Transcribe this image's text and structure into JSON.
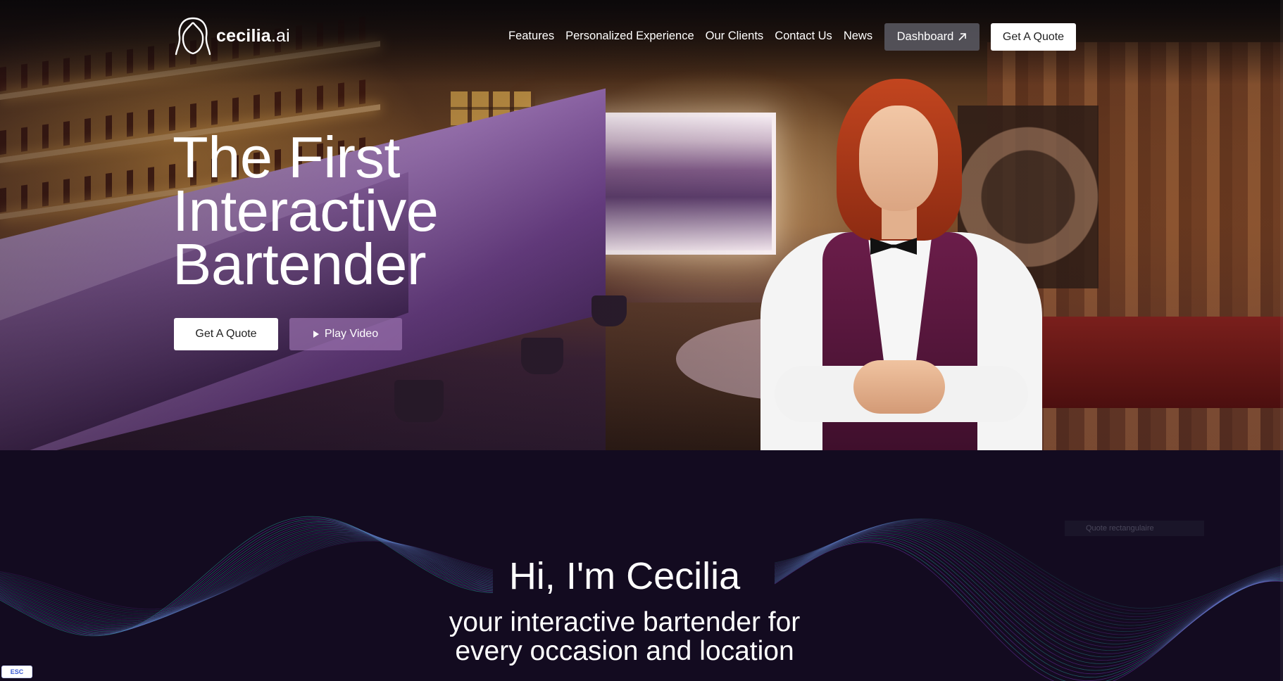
{
  "brand": {
    "name": "cecilia",
    "suffix": ".ai"
  },
  "nav": {
    "items": [
      "Features",
      "Personalized Experience",
      "Our Clients",
      "Contact Us",
      "News"
    ],
    "dashboard_label": "Dashboard",
    "quote_label": "Get A Quote"
  },
  "hero": {
    "title_lines": [
      "The First",
      "Interactive",
      "Bartender"
    ],
    "quote_button": "Get A Quote",
    "play_button": "Play Video"
  },
  "intro": {
    "title": "Hi, I'm Cecilia",
    "subtitle_lines": [
      "your interactive bartender for",
      "every occasion and location"
    ],
    "ghost_label": "Quote rectangulaire"
  },
  "overlay": {
    "esc_label": "ESC"
  },
  "colors": {
    "page_bg": "#130b20",
    "accent_button": "#ffffff",
    "dashboard_button": "#5a5a64",
    "play_button": "#966eaa",
    "wave_teal": "#2fb6b0",
    "wave_purple": "#8a3fd0"
  },
  "icons": {
    "logo": "woman-head-outline-icon",
    "dashboard": "arrow-up-right-icon",
    "play": "play-triangle-icon"
  }
}
